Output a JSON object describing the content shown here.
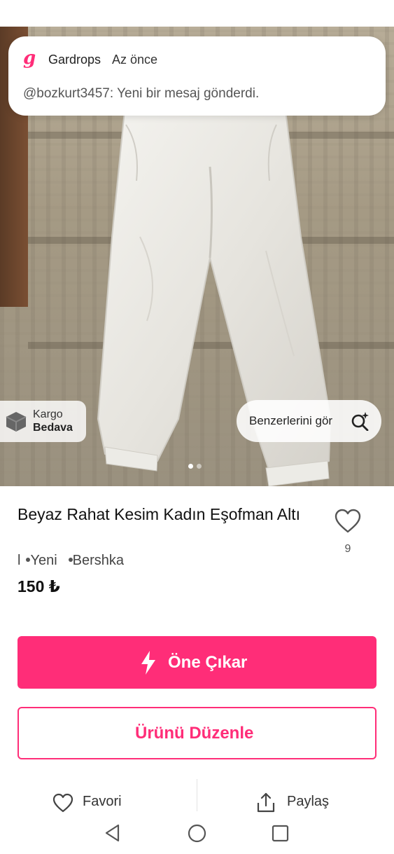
{
  "notification": {
    "app_name": "Gardrops",
    "time": "Az önce",
    "message": "@bozkurt3457: Yeni bir mesaj gönderdi.",
    "logo_text": "g",
    "logo_icon": "gardrops-logo"
  },
  "image_overlays": {
    "shipping_line1": "Kargo",
    "shipping_line2": "Bedava",
    "shipping_icon": "box-icon",
    "similar_label": "Benzerlerini gör",
    "similar_icon": "search-sparkle-icon",
    "carousel_pages": 2,
    "carousel_active": 1
  },
  "product": {
    "title": "Beyaz Rahat Kesim Kadın Eşofman Altı",
    "size": "l",
    "condition": "Yeni",
    "brand": "Bershka",
    "price": "150 ₺",
    "favorite_count": "9"
  },
  "actions": {
    "promote_label": "Öne Çıkar",
    "edit_label": "Ürünü Düzenle",
    "favorite_label": "Favori",
    "share_label": "Paylaş"
  },
  "colors": {
    "accent": "#ff2d78",
    "text": "#111111",
    "muted": "#555555"
  },
  "system_nav": [
    "back-icon",
    "home-icon",
    "recents-icon"
  ]
}
